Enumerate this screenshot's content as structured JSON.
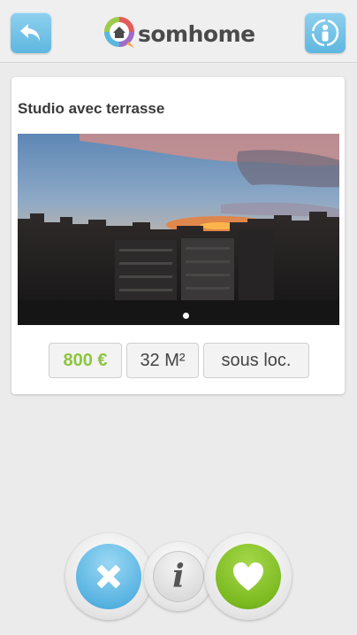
{
  "header": {
    "back_icon": "back-arrow-icon",
    "profile_icon": "user-circle-icon",
    "logo_text": "somhome",
    "colors": {
      "button": "#6cbde4",
      "logo_text": "#4a4a4a"
    }
  },
  "listing": {
    "title": "Studio avec terrasse",
    "photo_count": 1,
    "active_photo": 1,
    "tags": {
      "price": "800 €",
      "area": "32 M²",
      "type": "sous loc."
    },
    "colors": {
      "price": "#8cc63f"
    }
  },
  "actions": {
    "reject_icon": "close-x-icon",
    "info_icon": "info-icon",
    "info_glyph": "i",
    "like_icon": "heart-icon",
    "colors": {
      "reject": "#5ab4e2",
      "like": "#7dbb22"
    }
  }
}
